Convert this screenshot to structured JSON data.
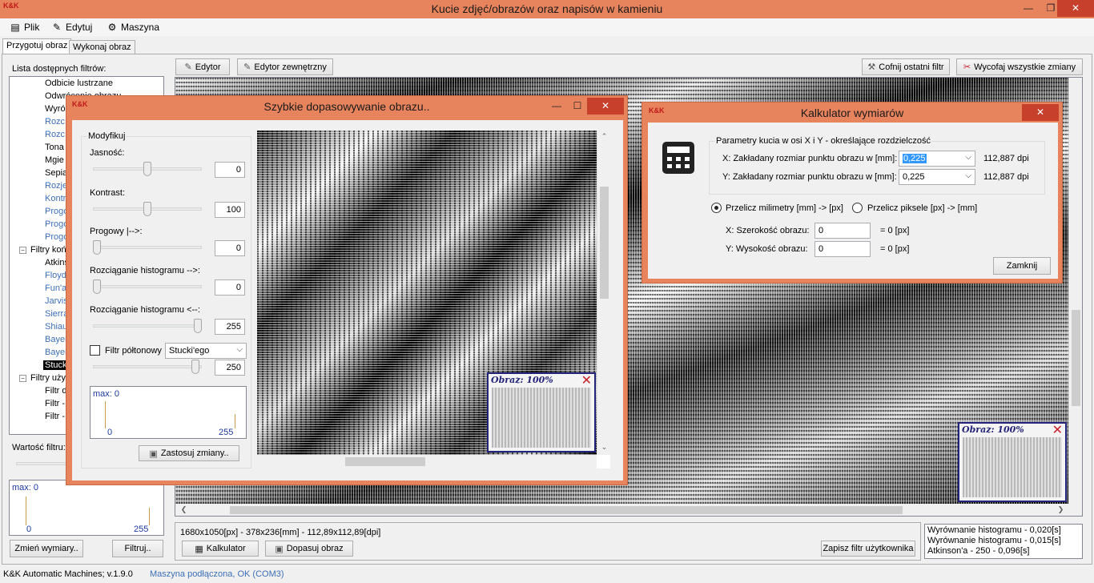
{
  "window": {
    "title": "Kucie zdjęć/obrazów oraz napisów w kamieniu",
    "logo": "K&K"
  },
  "menu": [
    {
      "label": "Plik",
      "icon": "document-icon"
    },
    {
      "label": "Edytuj",
      "icon": "pen-icon"
    },
    {
      "label": "Maszyna",
      "icon": "gear-icon"
    }
  ],
  "tabs": [
    {
      "label": "Przygotuj obraz",
      "active": true
    },
    {
      "label": "Wykonaj obraz",
      "active": false
    }
  ],
  "filters": {
    "title": "Lista dostępnych filtrów:",
    "items": [
      {
        "label": "Odbicie lustrzane",
        "color": "black"
      },
      {
        "label": "Odwrócenie obrazu",
        "color": "black"
      },
      {
        "label": "Wyró",
        "color": "black"
      },
      {
        "label": "Rozc",
        "color": "blue"
      },
      {
        "label": "Rozc",
        "color": "blue"
      },
      {
        "label": "Tona",
        "color": "black"
      },
      {
        "label": "Mgie",
        "color": "black"
      },
      {
        "label": "Sepia",
        "color": "black"
      },
      {
        "label": "Rozje",
        "color": "blue"
      },
      {
        "label": "Kontr",
        "color": "blue"
      },
      {
        "label": "Progo",
        "color": "blue"
      },
      {
        "label": "Progo",
        "color": "blue"
      },
      {
        "label": "Progo",
        "color": "blue"
      }
    ],
    "group2": "Filtry końc",
    "group2_items": [
      {
        "label": "Atkins",
        "color": "black"
      },
      {
        "label": "Floyd",
        "color": "blue"
      },
      {
        "label": "Fun'a",
        "color": "blue"
      },
      {
        "label": "Jarvis",
        "color": "blue"
      },
      {
        "label": "Sierra",
        "color": "blue"
      },
      {
        "label": "Shiau",
        "color": "blue"
      },
      {
        "label": "Bayer",
        "color": "blue"
      },
      {
        "label": "Bayer",
        "color": "blue"
      },
      {
        "label": "Stuck",
        "color": "selected"
      }
    ],
    "group3": "Filtry użyt",
    "group3_items": [
      {
        "label": "Filtr d"
      },
      {
        "label": "Filtr -"
      },
      {
        "label": "Filtr -"
      }
    ]
  },
  "filter_value": {
    "label": "Wartość filtru:"
  },
  "left_hist": {
    "max_label": "max: 0",
    "min": "0",
    "max": "255"
  },
  "left_buttons": {
    "change_dims": "Zmień wymiary..",
    "filter": "Filtruj.."
  },
  "toolbar": {
    "editor": "Edytor",
    "external_editor": "Edytor zewnętrzny",
    "undo_last": "Cofnij ostatni filtr",
    "revert_all": "Wycofaj wszystkie zmiany"
  },
  "preview_main": {
    "title": "Obraz: 100%"
  },
  "bottom": {
    "info": "1680x1050[px] - 378x236[mm] - 112,89x112,89[dpi]",
    "calculator": "Kalkulator",
    "fit_image": "Dopasuj obraz",
    "save_user_filter": "Zapisz filtr użytkownika",
    "log": [
      "Wyrównanie histogramu - 0,020[s]",
      "Wyrównanie histogramu - 0,015[s]",
      "Atkinson'a - 250 - 0,096[s]"
    ]
  },
  "quick_dialog": {
    "title": "Szybkie dopasowywanie obrazu..",
    "group": "Modyfikuj",
    "brightness": {
      "label": "Jasność:",
      "value": "0",
      "level": 0.5
    },
    "contrast": {
      "label": "Kontrast:",
      "value": "100",
      "level": 0.5
    },
    "threshold": {
      "label": "Progowy |-->:",
      "value": "0",
      "level": 0.0
    },
    "stretch_right": {
      "label": "Rozciąganie histogramu -->:",
      "value": "0",
      "level": 0.0
    },
    "stretch_left": {
      "label": "Rozciąganie histogramu <--:",
      "value": "255",
      "level": 1.0
    },
    "halftone": {
      "label": "Filtr półtonowy",
      "checked": false,
      "selected": "Stucki'ego",
      "value": "250",
      "level": 0.98
    },
    "hist": {
      "max_label": "max: 0",
      "min": "0",
      "max": "255"
    },
    "apply": "Zastosuj zmiany..",
    "preview_title": "Obraz: 100%"
  },
  "calc_dialog": {
    "title": "Kalkulator wymiarów",
    "group": "Parametry kucia w osi X i Y - określające rozdzielczość",
    "x_label": "X: Zakładany rozmiar punktu obrazu w [mm]:",
    "x_value": "0,225",
    "x_dpi": "112,887 dpi",
    "y_label": "Y: Zakładany rozmiar punktu obrazu w [mm]:",
    "y_value": "0,225",
    "y_dpi": "112,887 dpi",
    "radio_mm_px": "Przelicz milimetry [mm] -> [px]",
    "radio_px_mm": "Przelicz piksele [px] -> [mm]",
    "mode": "mm_to_px",
    "width_label": "X: Szerokość obrazu:",
    "width_value": "0",
    "width_result": "= 0 [px]",
    "height_label": "Y: Wysokość obrazu:",
    "height_value": "0",
    "height_result": "= 0 [px]",
    "close": "Zamknij"
  },
  "status": {
    "version": "K&K Automatic Machines; v.1.9.0",
    "connection": "Maszyna podłączona, OK (COM3)",
    "connection_color": "#3c6fb8"
  },
  "colors": {
    "titlebar": "#e8845d",
    "close_button": "#c7402b",
    "link_blue": "#3c6fb8",
    "preview_border": "#23237a"
  }
}
